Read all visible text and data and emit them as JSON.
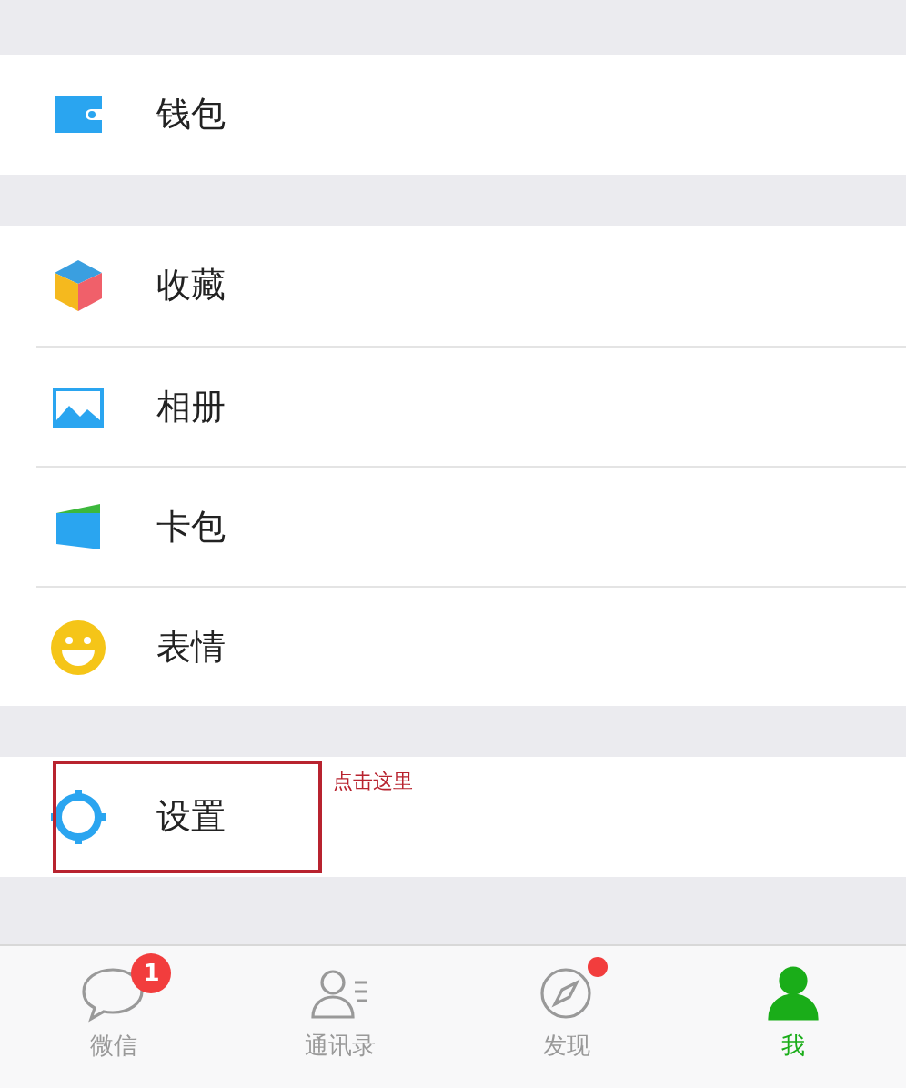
{
  "sections": [
    {
      "items": [
        {
          "label": "钱包"
        }
      ]
    },
    {
      "items": [
        {
          "label": "收藏"
        },
        {
          "label": "相册"
        },
        {
          "label": "卡包"
        },
        {
          "label": "表情"
        }
      ]
    },
    {
      "items": [
        {
          "label": "设置",
          "annotation": "点击这里"
        }
      ]
    }
  ],
  "tab_bar": [
    {
      "label": "微信",
      "selected": false,
      "badge": "1",
      "dot": false
    },
    {
      "label": "通讯录",
      "selected": false,
      "dot": false
    },
    {
      "label": "发现",
      "selected": false,
      "dot": true
    },
    {
      "label": "我",
      "selected": true,
      "dot": false
    }
  ]
}
